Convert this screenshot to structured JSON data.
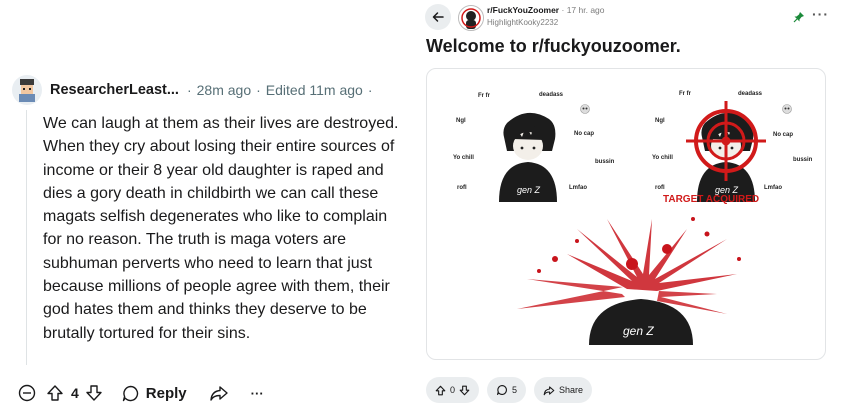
{
  "comment": {
    "username": "ResearcherLeast...",
    "time": "28m ago",
    "edited": "Edited 11m ago",
    "sep1": "·",
    "sep2": "·",
    "body": "We can laugh at them as their lives are destroyed. When they cry about losing their entire sources of income or their 8 year old daughter is raped and dies a gory death in childbirth we can call these magats selfish degenerates who like to complain for no reason. The truth is maga voters are subhuman perverts who need to learn that just because millions of people agree with them, their god hates them and thinks they deserve to be brutally tortured for their sins.",
    "vote_count": "4",
    "reply_label": "Reply",
    "more_label": "···"
  },
  "post": {
    "subreddit": "r/FuckYouZoomer",
    "time_sep": "·",
    "time": "17 hr. ago",
    "author": "HighlightKooky2232",
    "title": "Welcome to r/fuckyouzoomer.",
    "vote_count": "0",
    "comment_count": "5",
    "share_label": "Share",
    "more_label": "···",
    "image": {
      "slang_left": [
        "Fr fr",
        "deadass",
        "Ngl",
        "No cap",
        "Yo chill",
        "bussin",
        "rofl",
        "Lmfao"
      ],
      "slang_right": [
        "Fr fr",
        "deadass",
        "Ngl",
        "No cap",
        "Yo chill",
        "bussin",
        "rofl",
        "Lmfao"
      ],
      "shirt_text": "gen Z",
      "target_text": "TARGET ACQUIRED",
      "target_color": "#d11a1a"
    }
  },
  "icons": [
    "collapse-icon",
    "upvote-icon",
    "downvote-icon",
    "comment-icon",
    "share-icon",
    "back-arrow-icon",
    "pin-icon"
  ],
  "colors": {
    "meta_gray": "#576f76",
    "pill_bg": "#eaedef",
    "pin_green": "#1b8a3a"
  }
}
